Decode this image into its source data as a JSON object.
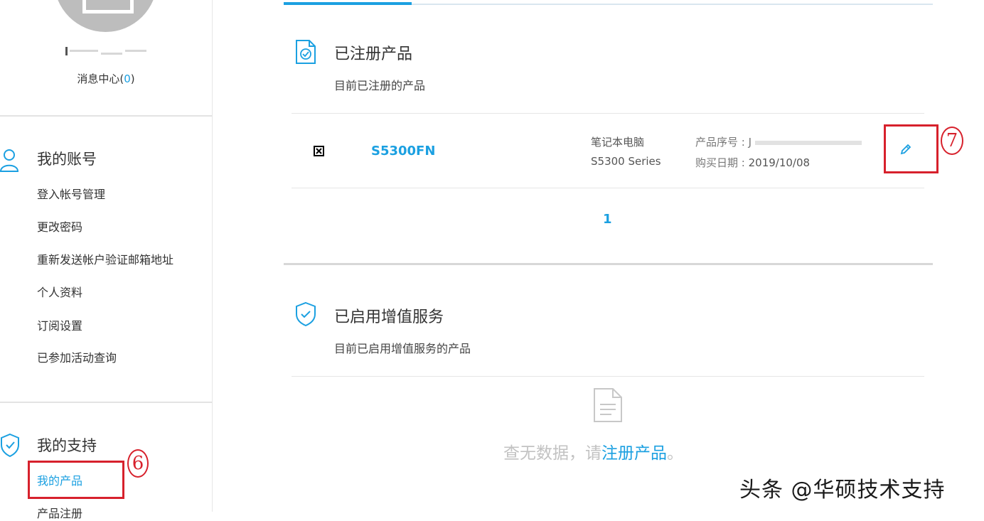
{
  "sidebar": {
    "message_center": {
      "label": "消息中心(",
      "count": "0",
      "suffix": ")"
    },
    "account": {
      "title": "我的账号",
      "items": [
        "登入帐号管理",
        "更改密码",
        "重新发送帐户验证邮箱地址",
        "个人资料",
        "订阅设置",
        "已参加活动查询"
      ]
    },
    "support": {
      "title": "我的支持",
      "items": [
        "我的产品",
        "产品注册"
      ]
    }
  },
  "annotations": {
    "step6": "6",
    "step7": "7"
  },
  "registered": {
    "title": "已注册产品",
    "subtitle": "目前已注册的产品",
    "product": {
      "name": "S5300FN",
      "category": "笔记本电脑",
      "series": "S5300 Series",
      "serial_label": "产品序号 :",
      "serial_value": "J",
      "date_label": "购买日期 :",
      "date_value": "2019/10/08"
    },
    "page": "1"
  },
  "services": {
    "title": "已启用增值服务",
    "subtitle": "目前已启用增值服务的产品",
    "empty_text": "查无数据，请",
    "empty_link": "注册产品",
    "empty_end": "。"
  },
  "watermark": "头条 @华硕技术支持",
  "colors": {
    "accent": "#1ba0e1",
    "annotation": "#d7212c"
  }
}
